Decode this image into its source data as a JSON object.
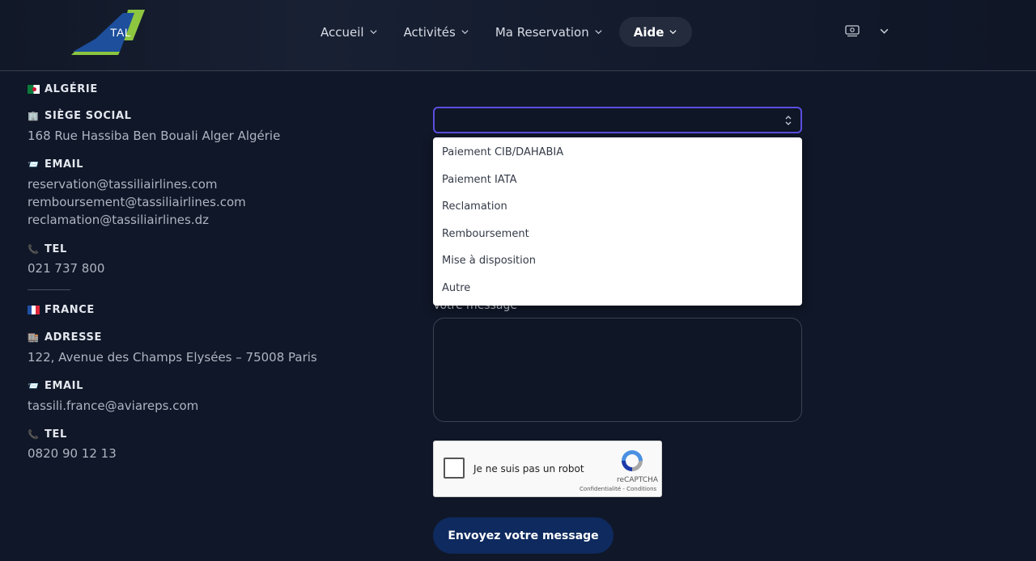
{
  "header": {
    "logo_text": "TAL",
    "nav": [
      {
        "label": "Accueil"
      },
      {
        "label": "Activités"
      },
      {
        "label": "Ma Reservation"
      },
      {
        "label": "Aide"
      }
    ]
  },
  "algeria": {
    "country": "ALGÉRIE",
    "siege_label": "SIÈGE SOCIAL",
    "siege_value": "168 Rue Hassiba Ben Bouali Alger Algérie",
    "email_label": "EMAIL",
    "emails": [
      "reservation@tassiliairlines.com",
      "remboursement@tassiliairlines.com",
      "reclamation@tassiliairlines.dz"
    ],
    "tel_label": "TEL",
    "tel_value": "021 737 800"
  },
  "france": {
    "country": "FRANCE",
    "address_label": "ADRESSE",
    "address_value": "122, Avenue des Champs Elysées – 75008 Paris",
    "email_label": "EMAIL",
    "email_value": "tassili.france@aviareps.com",
    "tel_label": "TEL",
    "tel_value": "0820 90 12 13"
  },
  "form": {
    "subject_options": [
      "Paiement CIB/DAHABIA",
      "Paiement IATA",
      "Reclamation",
      "Remboursement",
      "Mise à disposition",
      "Autre"
    ],
    "message_label": "Votre message",
    "recaptcha_text": "Je ne suis pas un robot",
    "recaptcha_brand": "reCAPTCHA",
    "recaptcha_links": "Confidentialité - Conditions",
    "submit_label": "Envoyez votre message"
  },
  "colors": {
    "background": "#101728",
    "accent_border": "#5b4ee0",
    "button": "#0e2a5e"
  }
}
